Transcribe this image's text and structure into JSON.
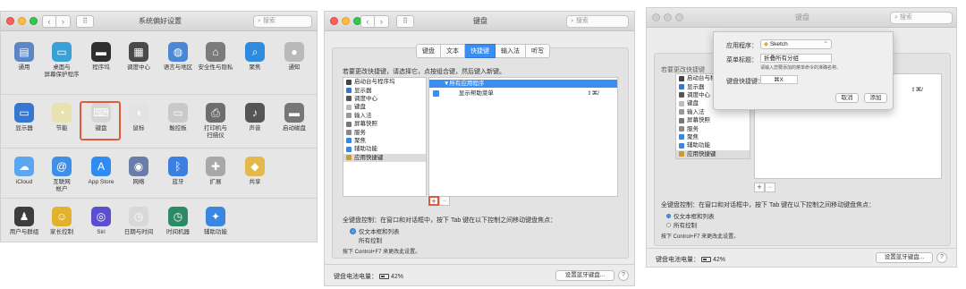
{
  "panel1": {
    "title": "系统偏好设置",
    "search_placeholder": "搜索",
    "row1": [
      {
        "label": "通用",
        "icon": "general-icon",
        "color": "#5b87c6",
        "glyph": "▤"
      },
      {
        "label": "桌面与\n屏幕保护程序",
        "icon": "desktop-icon",
        "color": "#3aa0d8",
        "glyph": "▭"
      },
      {
        "label": "程序坞",
        "icon": "dock-icon",
        "color": "#2f2f2f",
        "glyph": "▬"
      },
      {
        "label": "调度中心",
        "icon": "mission-control-icon",
        "color": "#4a4a4a",
        "glyph": "▦"
      },
      {
        "label": "语言与地区",
        "icon": "language-icon",
        "color": "#4a88d6",
        "glyph": "◍"
      },
      {
        "label": "安全性与隐私",
        "icon": "security-icon",
        "color": "#7b7b7b",
        "glyph": "⌂"
      },
      {
        "label": "聚焦",
        "icon": "spotlight-icon",
        "color": "#2e8be0",
        "glyph": "⌕"
      },
      {
        "label": "通知",
        "icon": "notifications-icon",
        "color": "#b9b9b9",
        "glyph": "●"
      }
    ],
    "row2": [
      {
        "label": "显示器",
        "icon": "displays-icon",
        "color": "#3478d0",
        "glyph": "▭"
      },
      {
        "label": "节能",
        "icon": "energy-saver-icon",
        "color": "#e8e2b0",
        "glyph": "◔"
      },
      {
        "label": "键盘",
        "icon": "keyboard-icon",
        "color": "#d6d6d6",
        "glyph": "⌨"
      },
      {
        "label": "鼠标",
        "icon": "mouse-icon",
        "color": "#e3e3e3",
        "glyph": "◖"
      },
      {
        "label": "触控板",
        "icon": "trackpad-icon",
        "color": "#c9c9c9",
        "glyph": "▭"
      },
      {
        "label": "打印机与\n扫描仪",
        "icon": "printers-icon",
        "color": "#6e6e6e",
        "glyph": "⎙"
      },
      {
        "label": "声音",
        "icon": "sound-icon",
        "color": "#555555",
        "glyph": "♪"
      },
      {
        "label": "启动磁盘",
        "icon": "startup-disk-icon",
        "color": "#777777",
        "glyph": "▬"
      }
    ],
    "row3": [
      {
        "label": "iCloud",
        "icon": "icloud-icon",
        "color": "#5aa7ef",
        "glyph": "☁"
      },
      {
        "label": "互联网\n帐户",
        "icon": "internet-accounts-icon",
        "color": "#3f8fe6",
        "glyph": "@"
      },
      {
        "label": "App Store",
        "icon": "app-store-icon",
        "color": "#2f8cf0",
        "glyph": "A"
      },
      {
        "label": "网络",
        "icon": "network-icon",
        "color": "#6a7da6",
        "glyph": "◉"
      },
      {
        "label": "蓝牙",
        "icon": "bluetooth-icon",
        "color": "#3b7fe0",
        "glyph": "ᛒ"
      },
      {
        "label": "扩展",
        "icon": "extensions-icon",
        "color": "#a8a8a8",
        "glyph": "✚"
      },
      {
        "label": "共享",
        "icon": "sharing-icon",
        "color": "#e4b84a",
        "glyph": "◆"
      }
    ],
    "row4": [
      {
        "label": "用户与群组",
        "icon": "users-icon",
        "color": "#3d3d3d",
        "glyph": "♟"
      },
      {
        "label": "家长控制",
        "icon": "parental-controls-icon",
        "color": "#e0b22e",
        "glyph": "☺"
      },
      {
        "label": "Siri",
        "icon": "siri-icon",
        "color": "#5b4fd0",
        "glyph": "◎"
      },
      {
        "label": "日期与时间",
        "icon": "date-time-icon",
        "color": "#d8d8d8",
        "glyph": "◷"
      },
      {
        "label": "时间机器",
        "icon": "time-machine-icon",
        "color": "#2d8a66",
        "glyph": "◷"
      },
      {
        "label": "辅助功能",
        "icon": "accessibility-icon",
        "color": "#3b86e0",
        "glyph": "✦"
      }
    ]
  },
  "panel2": {
    "title": "键盘",
    "search_placeholder": "搜索",
    "tabs": [
      {
        "label": "键盘",
        "active": false
      },
      {
        "label": "文本",
        "active": false
      },
      {
        "label": "快捷键",
        "active": true
      },
      {
        "label": "输入法",
        "active": false
      },
      {
        "label": "听写",
        "active": false
      }
    ],
    "instruction": "若要更改快捷键，请选择它，点按组合键，然后键入新键。",
    "categories": [
      {
        "label": "启动台与程序坞",
        "color": "#444"
      },
      {
        "label": "显示器",
        "color": "#3478d0"
      },
      {
        "label": "调度中心",
        "color": "#555"
      },
      {
        "label": "键盘",
        "color": "#bbb"
      },
      {
        "label": "输入法",
        "color": "#999"
      },
      {
        "label": "屏幕快照",
        "color": "#777"
      },
      {
        "label": "服务",
        "color": "#888"
      },
      {
        "label": "聚焦",
        "color": "#2e8be0"
      },
      {
        "label": "辅助功能",
        "color": "#3b86e0"
      },
      {
        "label": "应用快捷键",
        "color": "#c89a3a"
      }
    ],
    "group_header": "▼所有应用程序",
    "shortcut_row": {
      "label": "显示帮助菜单",
      "keys": "⇧⌘/"
    },
    "full_kb_label": "全键盘控制：在窗口和对话框中，按下 Tab 键在以下控制之间移动键盘焦点：",
    "radio1": "仅文本框和列表",
    "radio2": "所有控制",
    "hint": "按下 Control+F7 来更改此设置。",
    "battery_label": "键盘电池电量：",
    "battery_value": "42%",
    "bluetooth_button": "设置蓝牙键盘...",
    "help_label": "?",
    "add_label": "+",
    "remove_label": "−"
  },
  "panel3": {
    "title": "键盘",
    "search_placeholder": "搜索",
    "app_label": "应用程序：",
    "app_value": "Sketch",
    "menu_title_label": "菜单标题：",
    "menu_title_value": "折叠所有分组",
    "menu_hint": "请输入您要添加的菜单命令的准确名称。",
    "shortcut_label": "键盘快捷键：",
    "shortcut_value": "⌘X",
    "cancel_button": "取消",
    "add_button": "添加",
    "instruction": "若要更改快捷键",
    "categories": [
      {
        "label": "启动台与程序坞",
        "color": "#444"
      },
      {
        "label": "显示器",
        "color": "#3478d0"
      },
      {
        "label": "调度中心",
        "color": "#555"
      },
      {
        "label": "键盘",
        "color": "#bbb"
      },
      {
        "label": "输入法",
        "color": "#999"
      },
      {
        "label": "屏幕快照",
        "color": "#777"
      },
      {
        "label": "服务",
        "color": "#888"
      },
      {
        "label": "聚焦",
        "color": "#2e8be0"
      },
      {
        "label": "辅助功能",
        "color": "#3b86e0"
      },
      {
        "label": "应用快捷键",
        "color": "#c89a3a"
      }
    ],
    "shortcut_keys": "⇧⌘/",
    "full_kb_label": "全键盘控制：在窗口和对话框中，按下 Tab 键在以下控制之间移动键盘焦点：",
    "radio1": "仅文本框和列表",
    "radio2": "所有控制",
    "hint": "按下 Control+F7 来更改此设置。",
    "battery_label": "键盘电池电量：",
    "battery_value": "42%",
    "bluetooth_button": "设置蓝牙键盘...",
    "help_label": "?",
    "add_label": "+",
    "remove_label": "−"
  }
}
